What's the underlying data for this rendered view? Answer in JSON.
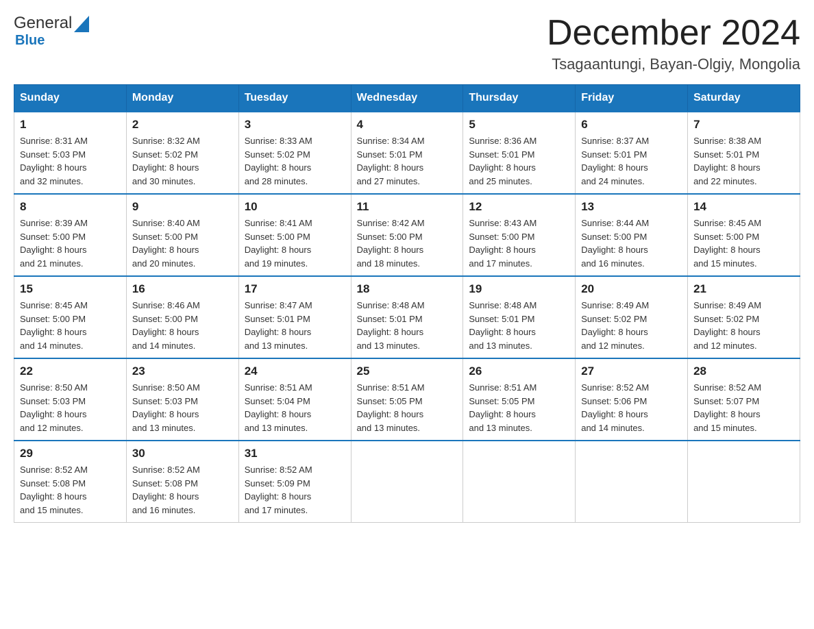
{
  "header": {
    "logo_general": "General",
    "logo_blue": "Blue",
    "main_title": "December 2024",
    "subtitle": "Tsagaantungi, Bayan-Olgiy, Mongolia"
  },
  "days_of_week": [
    "Sunday",
    "Monday",
    "Tuesday",
    "Wednesday",
    "Thursday",
    "Friday",
    "Saturday"
  ],
  "weeks": [
    [
      {
        "num": "1",
        "sunrise": "8:31 AM",
        "sunset": "5:03 PM",
        "daylight": "8 hours and 32 minutes."
      },
      {
        "num": "2",
        "sunrise": "8:32 AM",
        "sunset": "5:02 PM",
        "daylight": "8 hours and 30 minutes."
      },
      {
        "num": "3",
        "sunrise": "8:33 AM",
        "sunset": "5:02 PM",
        "daylight": "8 hours and 28 minutes."
      },
      {
        "num": "4",
        "sunrise": "8:34 AM",
        "sunset": "5:01 PM",
        "daylight": "8 hours and 27 minutes."
      },
      {
        "num": "5",
        "sunrise": "8:36 AM",
        "sunset": "5:01 PM",
        "daylight": "8 hours and 25 minutes."
      },
      {
        "num": "6",
        "sunrise": "8:37 AM",
        "sunset": "5:01 PM",
        "daylight": "8 hours and 24 minutes."
      },
      {
        "num": "7",
        "sunrise": "8:38 AM",
        "sunset": "5:01 PM",
        "daylight": "8 hours and 22 minutes."
      }
    ],
    [
      {
        "num": "8",
        "sunrise": "8:39 AM",
        "sunset": "5:00 PM",
        "daylight": "8 hours and 21 minutes."
      },
      {
        "num": "9",
        "sunrise": "8:40 AM",
        "sunset": "5:00 PM",
        "daylight": "8 hours and 20 minutes."
      },
      {
        "num": "10",
        "sunrise": "8:41 AM",
        "sunset": "5:00 PM",
        "daylight": "8 hours and 19 minutes."
      },
      {
        "num": "11",
        "sunrise": "8:42 AM",
        "sunset": "5:00 PM",
        "daylight": "8 hours and 18 minutes."
      },
      {
        "num": "12",
        "sunrise": "8:43 AM",
        "sunset": "5:00 PM",
        "daylight": "8 hours and 17 minutes."
      },
      {
        "num": "13",
        "sunrise": "8:44 AM",
        "sunset": "5:00 PM",
        "daylight": "8 hours and 16 minutes."
      },
      {
        "num": "14",
        "sunrise": "8:45 AM",
        "sunset": "5:00 PM",
        "daylight": "8 hours and 15 minutes."
      }
    ],
    [
      {
        "num": "15",
        "sunrise": "8:45 AM",
        "sunset": "5:00 PM",
        "daylight": "8 hours and 14 minutes."
      },
      {
        "num": "16",
        "sunrise": "8:46 AM",
        "sunset": "5:00 PM",
        "daylight": "8 hours and 14 minutes."
      },
      {
        "num": "17",
        "sunrise": "8:47 AM",
        "sunset": "5:01 PM",
        "daylight": "8 hours and 13 minutes."
      },
      {
        "num": "18",
        "sunrise": "8:48 AM",
        "sunset": "5:01 PM",
        "daylight": "8 hours and 13 minutes."
      },
      {
        "num": "19",
        "sunrise": "8:48 AM",
        "sunset": "5:01 PM",
        "daylight": "8 hours and 13 minutes."
      },
      {
        "num": "20",
        "sunrise": "8:49 AM",
        "sunset": "5:02 PM",
        "daylight": "8 hours and 12 minutes."
      },
      {
        "num": "21",
        "sunrise": "8:49 AM",
        "sunset": "5:02 PM",
        "daylight": "8 hours and 12 minutes."
      }
    ],
    [
      {
        "num": "22",
        "sunrise": "8:50 AM",
        "sunset": "5:03 PM",
        "daylight": "8 hours and 12 minutes."
      },
      {
        "num": "23",
        "sunrise": "8:50 AM",
        "sunset": "5:03 PM",
        "daylight": "8 hours and 13 minutes."
      },
      {
        "num": "24",
        "sunrise": "8:51 AM",
        "sunset": "5:04 PM",
        "daylight": "8 hours and 13 minutes."
      },
      {
        "num": "25",
        "sunrise": "8:51 AM",
        "sunset": "5:05 PM",
        "daylight": "8 hours and 13 minutes."
      },
      {
        "num": "26",
        "sunrise": "8:51 AM",
        "sunset": "5:05 PM",
        "daylight": "8 hours and 13 minutes."
      },
      {
        "num": "27",
        "sunrise": "8:52 AM",
        "sunset": "5:06 PM",
        "daylight": "8 hours and 14 minutes."
      },
      {
        "num": "28",
        "sunrise": "8:52 AM",
        "sunset": "5:07 PM",
        "daylight": "8 hours and 15 minutes."
      }
    ],
    [
      {
        "num": "29",
        "sunrise": "8:52 AM",
        "sunset": "5:08 PM",
        "daylight": "8 hours and 15 minutes."
      },
      {
        "num": "30",
        "sunrise": "8:52 AM",
        "sunset": "5:08 PM",
        "daylight": "8 hours and 16 minutes."
      },
      {
        "num": "31",
        "sunrise": "8:52 AM",
        "sunset": "5:09 PM",
        "daylight": "8 hours and 17 minutes."
      },
      null,
      null,
      null,
      null
    ]
  ],
  "labels": {
    "sunrise": "Sunrise:",
    "sunset": "Sunset:",
    "daylight": "Daylight:"
  }
}
